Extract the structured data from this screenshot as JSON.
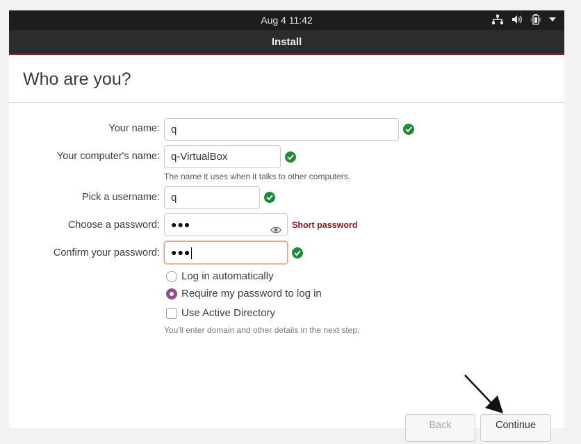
{
  "topbar": {
    "datetime": "Aug 4  11:42",
    "icons": [
      "network-icon",
      "volume-icon",
      "battery-icon",
      "system-menu-chevron-icon"
    ]
  },
  "window": {
    "title": "Install"
  },
  "page": {
    "heading": "Who are you?"
  },
  "form": {
    "name": {
      "label": "Your name:",
      "value": "q",
      "valid": true
    },
    "computer_name": {
      "label": "Your computer's name:",
      "value": "q-VirtualBox",
      "valid": true,
      "hint": "The name it uses when it talks to other computers."
    },
    "username": {
      "label": "Pick a username:",
      "value": "q",
      "valid": true
    },
    "password": {
      "label": "Choose a password:",
      "masked": "●●●",
      "strength": "Short password"
    },
    "confirm_password": {
      "label": "Confirm your password:",
      "masked": "●●●",
      "valid": true
    }
  },
  "login_options": {
    "auto_login": {
      "label": "Log in automatically",
      "selected": false
    },
    "require_password": {
      "label": "Require my password to log in",
      "selected": true
    },
    "active_directory": {
      "label": "Use Active Directory",
      "checked": false
    },
    "ad_hint": "You'll enter domain and other details in the next step."
  },
  "buttons": {
    "back": "Back",
    "continue": "Continue"
  },
  "colors": {
    "valid": "#218a3a",
    "warning": "#8b1a1a",
    "accent": "#924d8b",
    "focus": "#e9a07a"
  }
}
